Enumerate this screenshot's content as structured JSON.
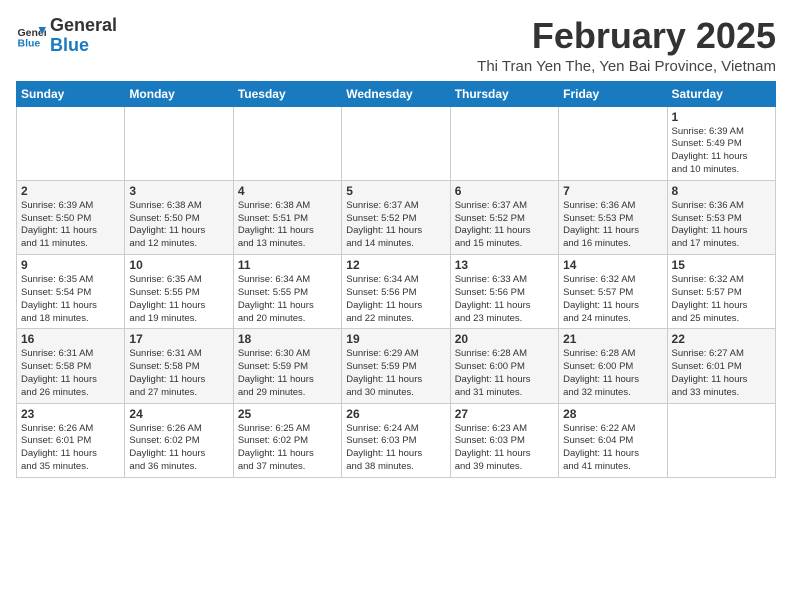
{
  "header": {
    "logo_line1": "General",
    "logo_line2": "Blue",
    "month": "February 2025",
    "location": "Thi Tran Yen The, Yen Bai Province, Vietnam"
  },
  "weekdays": [
    "Sunday",
    "Monday",
    "Tuesday",
    "Wednesday",
    "Thursday",
    "Friday",
    "Saturday"
  ],
  "weeks": [
    [
      {
        "day": "",
        "info": ""
      },
      {
        "day": "",
        "info": ""
      },
      {
        "day": "",
        "info": ""
      },
      {
        "day": "",
        "info": ""
      },
      {
        "day": "",
        "info": ""
      },
      {
        "day": "",
        "info": ""
      },
      {
        "day": "1",
        "info": "Sunrise: 6:39 AM\nSunset: 5:49 PM\nDaylight: 11 hours\nand 10 minutes."
      }
    ],
    [
      {
        "day": "2",
        "info": "Sunrise: 6:39 AM\nSunset: 5:50 PM\nDaylight: 11 hours\nand 11 minutes."
      },
      {
        "day": "3",
        "info": "Sunrise: 6:38 AM\nSunset: 5:50 PM\nDaylight: 11 hours\nand 12 minutes."
      },
      {
        "day": "4",
        "info": "Sunrise: 6:38 AM\nSunset: 5:51 PM\nDaylight: 11 hours\nand 13 minutes."
      },
      {
        "day": "5",
        "info": "Sunrise: 6:37 AM\nSunset: 5:52 PM\nDaylight: 11 hours\nand 14 minutes."
      },
      {
        "day": "6",
        "info": "Sunrise: 6:37 AM\nSunset: 5:52 PM\nDaylight: 11 hours\nand 15 minutes."
      },
      {
        "day": "7",
        "info": "Sunrise: 6:36 AM\nSunset: 5:53 PM\nDaylight: 11 hours\nand 16 minutes."
      },
      {
        "day": "8",
        "info": "Sunrise: 6:36 AM\nSunset: 5:53 PM\nDaylight: 11 hours\nand 17 minutes."
      }
    ],
    [
      {
        "day": "9",
        "info": "Sunrise: 6:35 AM\nSunset: 5:54 PM\nDaylight: 11 hours\nand 18 minutes."
      },
      {
        "day": "10",
        "info": "Sunrise: 6:35 AM\nSunset: 5:55 PM\nDaylight: 11 hours\nand 19 minutes."
      },
      {
        "day": "11",
        "info": "Sunrise: 6:34 AM\nSunset: 5:55 PM\nDaylight: 11 hours\nand 20 minutes."
      },
      {
        "day": "12",
        "info": "Sunrise: 6:34 AM\nSunset: 5:56 PM\nDaylight: 11 hours\nand 22 minutes."
      },
      {
        "day": "13",
        "info": "Sunrise: 6:33 AM\nSunset: 5:56 PM\nDaylight: 11 hours\nand 23 minutes."
      },
      {
        "day": "14",
        "info": "Sunrise: 6:32 AM\nSunset: 5:57 PM\nDaylight: 11 hours\nand 24 minutes."
      },
      {
        "day": "15",
        "info": "Sunrise: 6:32 AM\nSunset: 5:57 PM\nDaylight: 11 hours\nand 25 minutes."
      }
    ],
    [
      {
        "day": "16",
        "info": "Sunrise: 6:31 AM\nSunset: 5:58 PM\nDaylight: 11 hours\nand 26 minutes."
      },
      {
        "day": "17",
        "info": "Sunrise: 6:31 AM\nSunset: 5:58 PM\nDaylight: 11 hours\nand 27 minutes."
      },
      {
        "day": "18",
        "info": "Sunrise: 6:30 AM\nSunset: 5:59 PM\nDaylight: 11 hours\nand 29 minutes."
      },
      {
        "day": "19",
        "info": "Sunrise: 6:29 AM\nSunset: 5:59 PM\nDaylight: 11 hours\nand 30 minutes."
      },
      {
        "day": "20",
        "info": "Sunrise: 6:28 AM\nSunset: 6:00 PM\nDaylight: 11 hours\nand 31 minutes."
      },
      {
        "day": "21",
        "info": "Sunrise: 6:28 AM\nSunset: 6:00 PM\nDaylight: 11 hours\nand 32 minutes."
      },
      {
        "day": "22",
        "info": "Sunrise: 6:27 AM\nSunset: 6:01 PM\nDaylight: 11 hours\nand 33 minutes."
      }
    ],
    [
      {
        "day": "23",
        "info": "Sunrise: 6:26 AM\nSunset: 6:01 PM\nDaylight: 11 hours\nand 35 minutes."
      },
      {
        "day": "24",
        "info": "Sunrise: 6:26 AM\nSunset: 6:02 PM\nDaylight: 11 hours\nand 36 minutes."
      },
      {
        "day": "25",
        "info": "Sunrise: 6:25 AM\nSunset: 6:02 PM\nDaylight: 11 hours\nand 37 minutes."
      },
      {
        "day": "26",
        "info": "Sunrise: 6:24 AM\nSunset: 6:03 PM\nDaylight: 11 hours\nand 38 minutes."
      },
      {
        "day": "27",
        "info": "Sunrise: 6:23 AM\nSunset: 6:03 PM\nDaylight: 11 hours\nand 39 minutes."
      },
      {
        "day": "28",
        "info": "Sunrise: 6:22 AM\nSunset: 6:04 PM\nDaylight: 11 hours\nand 41 minutes."
      },
      {
        "day": "",
        "info": ""
      }
    ]
  ]
}
